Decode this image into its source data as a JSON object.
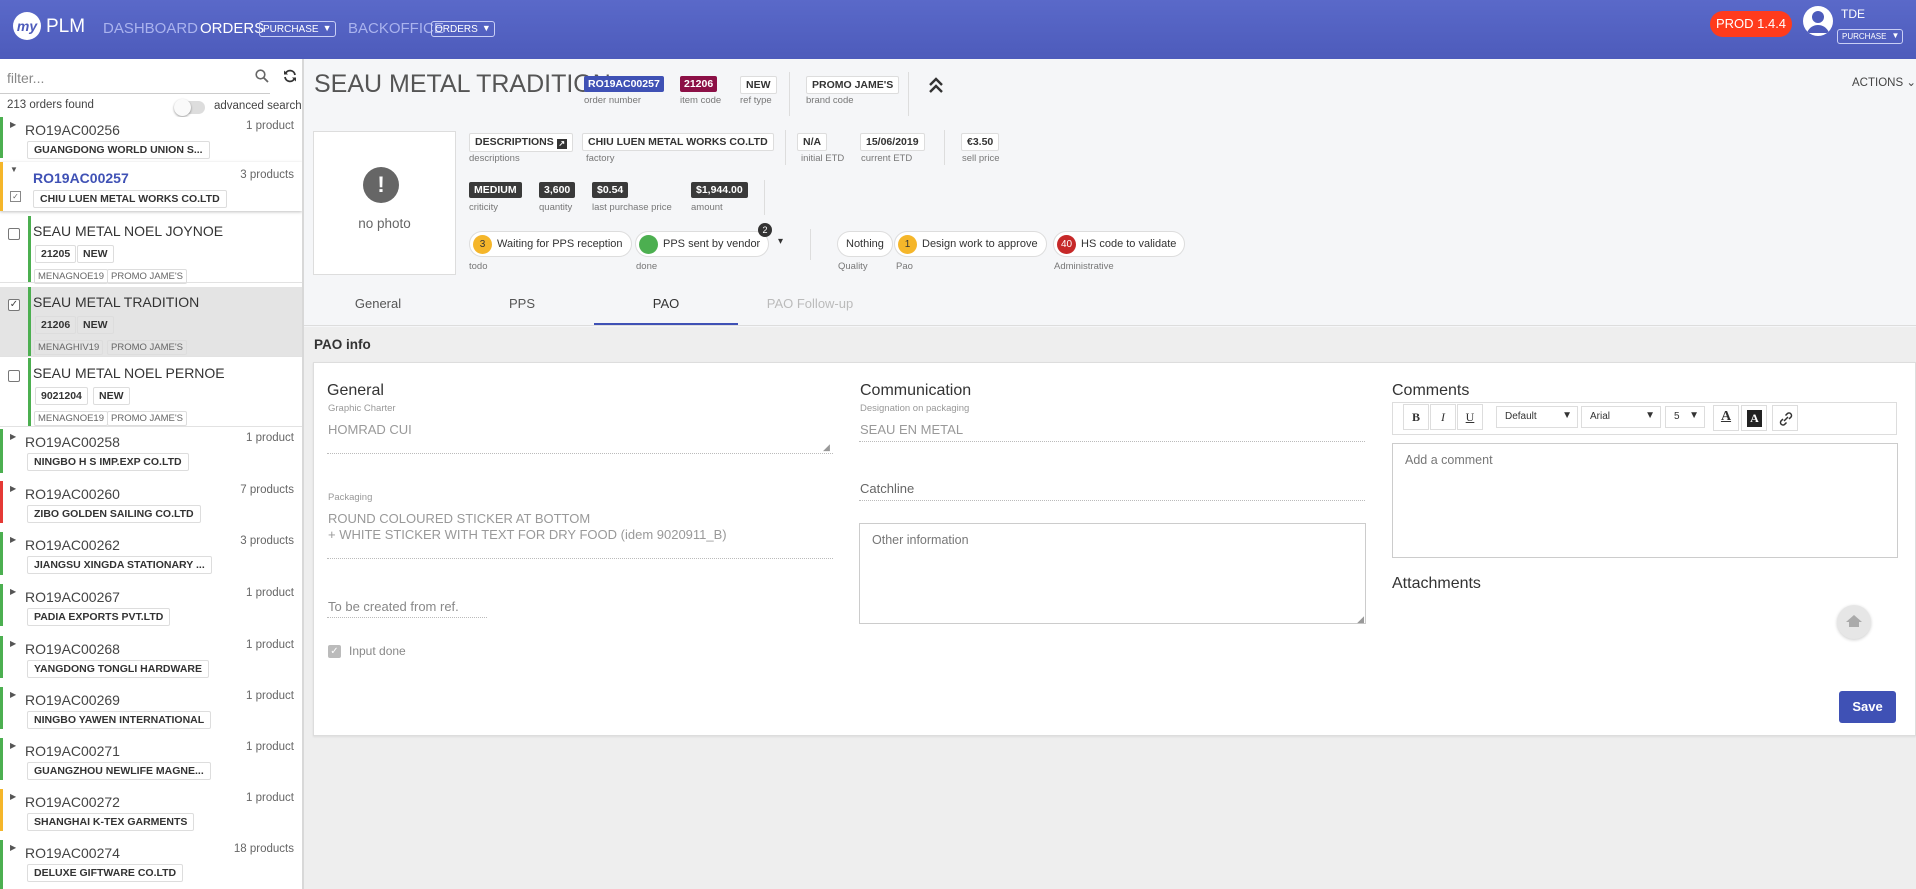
{
  "header": {
    "logo_mark": "my",
    "app_name": "PLM",
    "nav": {
      "dashboard": "DASHBOARD",
      "orders": "ORDERS",
      "orders_select": "PURCHASE",
      "backoffice": "BACKOFFICE",
      "backoffice_select": "ORDERS"
    },
    "env_badge": "PROD 1.4.4",
    "user": {
      "name": "TDE",
      "role_select": "PURCHASE"
    }
  },
  "sidebar": {
    "filter_placeholder": "filter...",
    "count_text": "213 orders found",
    "advanced_search": "advanced search",
    "orders": [
      {
        "code": "RO19AC00256",
        "count": "1 product",
        "vendor": "GUANGDONG WORLD UNION S...",
        "bar": "#4caf50"
      },
      {
        "code": "RO19AC00257",
        "count": "3 products",
        "vendor": "CHIU LUEN METAL WORKS CO.LTD",
        "bar": "#f5b62a",
        "expanded": true
      },
      {
        "code": "RO19AC00258",
        "count": "1 product",
        "vendor": "NINGBO H S IMP.EXP CO.LTD",
        "bar": "#4caf50"
      },
      {
        "code": "RO19AC00260",
        "count": "7 products",
        "vendor": "ZIBO GOLDEN SAILING CO.LTD",
        "bar": "#e53935"
      },
      {
        "code": "RO19AC00262",
        "count": "3 products",
        "vendor": "JIANGSU XINGDA STATIONARY ...",
        "bar": "#4caf50"
      },
      {
        "code": "RO19AC00267",
        "count": "1 product",
        "vendor": "PADIA EXPORTS PVT.LTD",
        "bar": "#4caf50"
      },
      {
        "code": "RO19AC00268",
        "count": "1 product",
        "vendor": "YANGDONG TONGLI HARDWARE",
        "bar": "#4caf50"
      },
      {
        "code": "RO19AC00269",
        "count": "1 product",
        "vendor": "NINGBO YAWEN INTERNATIONAL",
        "bar": "#4caf50"
      },
      {
        "code": "RO19AC00271",
        "count": "1 product",
        "vendor": "GUANGZHOU NEWLIFE MAGNE...",
        "bar": "#4caf50"
      },
      {
        "code": "RO19AC00272",
        "count": "1 product",
        "vendor": "SHANGHAI K-TEX GARMENTS",
        "bar": "#f5b62a"
      },
      {
        "code": "RO19AC00274",
        "count": "18 products",
        "vendor": "DELUXE GIFTWARE CO.LTD",
        "bar": "#4caf50"
      }
    ],
    "products": [
      {
        "title": "SEAU METAL NOEL JOYNOE",
        "item": "21205",
        "ref": "NEW",
        "tag1": "MENAGNOE19",
        "tag2": "PROMO JAME'S",
        "checked": false
      },
      {
        "title": "SEAU METAL TRADITION",
        "item": "21206",
        "ref": "NEW",
        "tag1": "MENAGHIV19",
        "tag2": "PROMO JAME'S",
        "checked": true
      },
      {
        "title": "SEAU METAL NOEL PERNOE",
        "item": "9021204",
        "ref": "NEW",
        "tag1": "MENAGNOE19",
        "tag2": "PROMO JAME'S",
        "checked": false
      }
    ]
  },
  "product": {
    "title": "SEAU METAL TRADITION",
    "order_number": "RO19AC00257",
    "order_number_label": "order number",
    "item_code": "21206",
    "item_code_label": "item code",
    "ref_type": "NEW",
    "ref_type_label": "ref type",
    "brand_code": "PROMO JAME'S",
    "brand_code_label": "brand code",
    "actions": "ACTIONS",
    "no_photo": "no photo",
    "descriptions": "DESCRIPTIONS",
    "descriptions_label": "descriptions",
    "factory": "CHIU LUEN METAL WORKS CO.LTD",
    "factory_label": "factory",
    "initial_etd": "N/A",
    "initial_etd_label": "initial ETD",
    "current_etd": "15/06/2019",
    "current_etd_label": "current ETD",
    "sell_price": "€3.50",
    "sell_price_label": "sell price",
    "criticity": "MEDIUM",
    "criticity_label": "criticity",
    "quantity": "3,600",
    "quantity_label": "quantity",
    "last_purchase_price": "$0.54",
    "last_purchase_price_label": "last purchase price",
    "amount": "$1,944.00",
    "amount_label": "amount",
    "status": {
      "todo": {
        "count": "3",
        "text": "Waiting for PPS reception",
        "label": "todo"
      },
      "done": {
        "text": "PPS sent by vendor",
        "badge": "2",
        "label": "done"
      },
      "quality": {
        "text": "Nothing",
        "label": "Quality"
      },
      "pao": {
        "count": "1",
        "text": "Design work to approve",
        "label": "Pao"
      },
      "admin": {
        "count": "40",
        "text": "HS code to validate",
        "label": "Administrative"
      }
    }
  },
  "tabs": [
    "General",
    "PPS",
    "PAO",
    "PAO Follow-up"
  ],
  "pao": {
    "section_title": "PAO info",
    "general": {
      "title": "General",
      "graphic_charter_label": "Graphic Charter",
      "graphic_charter": "HOMRAD CUI",
      "packaging_label": "Packaging",
      "packaging_line1": "ROUND COLOURED STICKER AT BOTTOM",
      "packaging_line2": "+ WHITE STICKER WITH TEXT FOR DRY FOOD (idem 9020911_B)",
      "to_be_created": "To be created from ref.",
      "input_done": "Input done"
    },
    "communication": {
      "title": "Communication",
      "designation_label": "Designation on packaging",
      "designation": "SEAU EN METAL",
      "catchline": "Catchline",
      "other_info": "Other information"
    },
    "comments": {
      "title": "Comments",
      "bold": "B",
      "italic": "I",
      "underline": "U",
      "style": "Default",
      "font": "Arial",
      "size": "5",
      "placeholder": "Add a comment",
      "attachments": "Attachments",
      "save": "Save"
    }
  }
}
